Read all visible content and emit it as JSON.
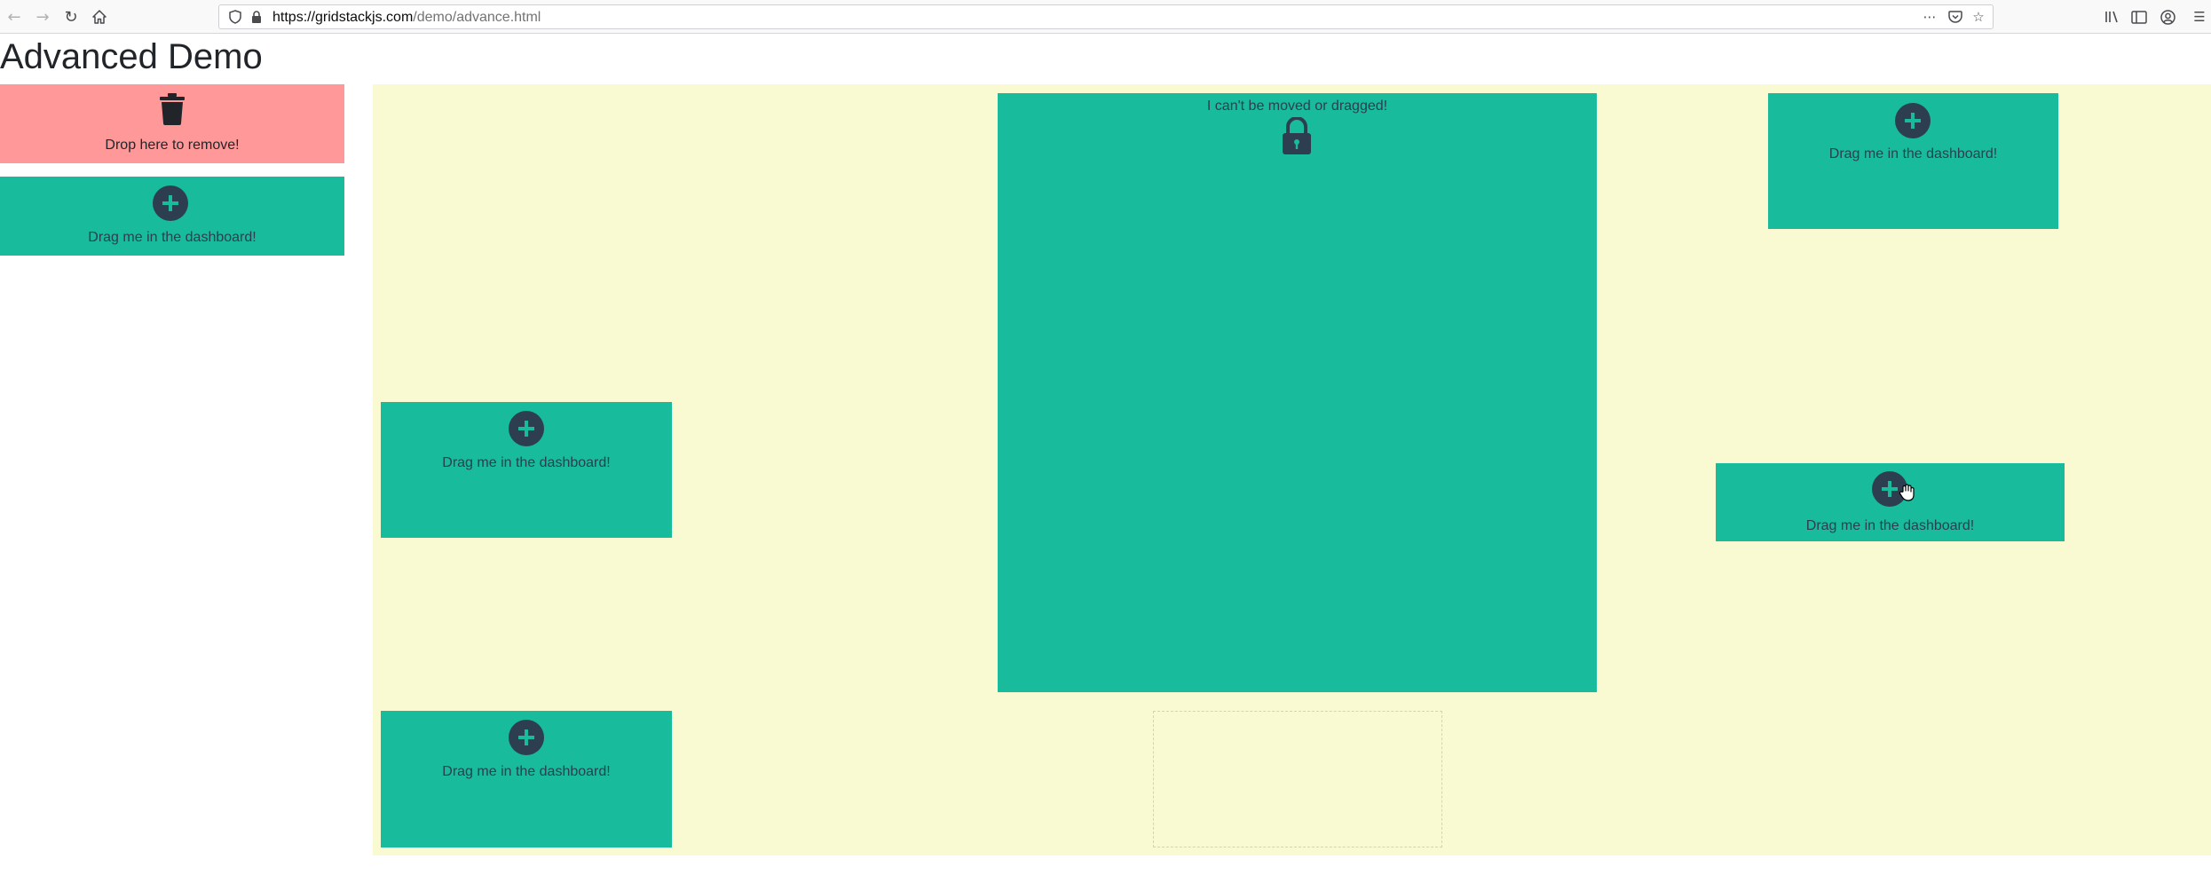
{
  "browser": {
    "url_host": "https://gridstackjs.com",
    "url_path": "/demo/advance.html",
    "icons": {
      "back": "back-arrow-icon",
      "forward": "forward-arrow-icon",
      "reload": "reload-icon",
      "home": "home-icon",
      "shield": "tracking-shield-icon",
      "lock": "padlock-icon",
      "more": "ellipsis-icon",
      "pocket": "pocket-icon",
      "bookmark": "star-icon",
      "library": "library-icon",
      "sidebar": "sidebar-icon",
      "account": "account-icon",
      "menu": "hamburger-menu-icon"
    }
  },
  "page": {
    "title": "Advanced Demo"
  },
  "trash": {
    "label": "Drop here to remove!",
    "color": "#ff9999",
    "icon": "trash-icon"
  },
  "sidebar": {
    "widget_label": "Drag me in the dashboard!"
  },
  "grid": {
    "background": "#fafad2",
    "widget_color": "#18bc9c",
    "locked_widget": {
      "label": "I can't be moved or dragged!",
      "icon": "lock-icon"
    },
    "widgets": [
      {
        "label": "Drag me in the dashboard!"
      },
      {
        "label": "Drag me in the dashboard!"
      },
      {
        "label": "Drag me in the dashboard!"
      },
      {
        "label": "Drag me in the dashboard!"
      }
    ]
  }
}
